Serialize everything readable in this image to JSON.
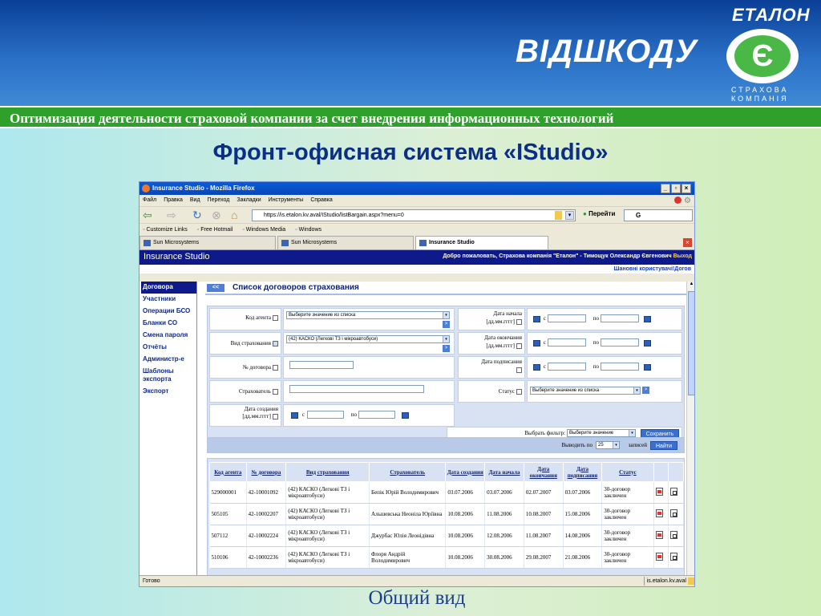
{
  "slide": {
    "logo_top": "ЕТАЛОН",
    "logo_main": "ВІДШКОДУ",
    "logo_badge": "Є",
    "logo_sub": "СТРАХОВА КОМПАНІЯ",
    "banner": "Оптимизация деятельности страховой компании за счет внедрения информационных технологий",
    "title": "Фронт-офисная система «IStudio»",
    "caption": "Общий вид"
  },
  "browser": {
    "window_title": "Insurance Studio - Mozilla Firefox",
    "menu": [
      "Файл",
      "Правка",
      "Вид",
      "Переход",
      "Закладки",
      "Инструменты",
      "Справка"
    ],
    "address": "https://is.etalon.kv.aval/IStudio/listBargain.aspx?menu=0",
    "go_label": "Перейти",
    "search_value": "G",
    "bookmarks": [
      "Customize Links",
      "Free Hotmail",
      "Windows Media",
      "Windows"
    ],
    "tabs": [
      "Sun Microsystems",
      "Sun Microsystems",
      "Insurance Studio"
    ],
    "status": "Готово",
    "status_host": "is.etalon.kv.aval"
  },
  "app": {
    "name": "Insurance Studio",
    "welcome": "Добро пожаловать, Страхова компанія \"Еталон\" - Тимощук Олександр Євгенович",
    "logout": "Выход",
    "user_links": "Шановні користувачі!Догов",
    "sidebar": [
      "Договора",
      "Участники",
      "Операции БСО",
      "Бланки СО",
      "Смена пароля",
      "Отчёты",
      "Администр-е",
      "Шаблоны экспорта",
      "Экспорт"
    ],
    "section_title": "Список договоров страхования",
    "back_label": "<<",
    "filter": {
      "agent_code": "Код агента",
      "agent_select": "Выберите значение из списка",
      "insurance_type": "Вид страхования",
      "insurance_type_value": "(42) КАСКО (Легкові ТЗ і мікроавтобуси)",
      "contract_no": "№ договора",
      "insurer": "Страхователь",
      "created_date": "Дата создания",
      "date_format": "[дд.мм.гггг]",
      "start_date": "Дата начала",
      "end_date": "Дата окончания",
      "sign_date": "Дата подписания",
      "status": "Статус",
      "status_select": "Выберите значение из списка",
      "from": "с",
      "to": "по",
      "go_arrow": ">",
      "choose_filter": "Выбрать фильтр:",
      "filter_select": "Выберите значение",
      "save_button": "Сохранить",
      "show_by": "Выводить по",
      "page_size": "25",
      "records": "записей",
      "find_button": "Найти"
    },
    "table": {
      "headers": [
        "Код агента",
        "№ договора",
        "Вид страхования",
        "Страхователь",
        "Дата создания",
        "Дата начала",
        "Дата окончания",
        "Дата подписания",
        "Статус"
      ],
      "rows": [
        [
          "529000001",
          "42-10001092",
          "(42) КАСКО (Легкові ТЗ і мікроавтобуси)",
          "Бепік Юрій Володимирович",
          "03.07.2006",
          "03.07.2006",
          "02.07.2007",
          "03.07.2006",
          "30-договор заключен"
        ],
        [
          "505105",
          "42-10002207",
          "(42) КАСКО (Легкові ТЗ і мікроавтобуси)",
          "Альшевська Неоніла Юріївна",
          "10.08.2006",
          "11.08.2006",
          "10.08.2007",
          "15.08.2006",
          "30-договор заключен"
        ],
        [
          "507112",
          "42-10002224",
          "(42) КАСКО (Легкові ТЗ і мікроавтобуси)",
          "Джурбас Юлія Леонідівна",
          "10.08.2006",
          "12.08.2006",
          "11.08.2007",
          "14.08.2006",
          "30-договор заключен"
        ],
        [
          "510106",
          "42-10002236",
          "(42) КАСКО (Легкові ТЗ і мікроавтобуси)",
          "Флоря Андрій Володимирович",
          "10.08.2006",
          "30.08.2006",
          "29.08.2007",
          "21.08.2006",
          "30-договор заключен"
        ]
      ]
    }
  }
}
